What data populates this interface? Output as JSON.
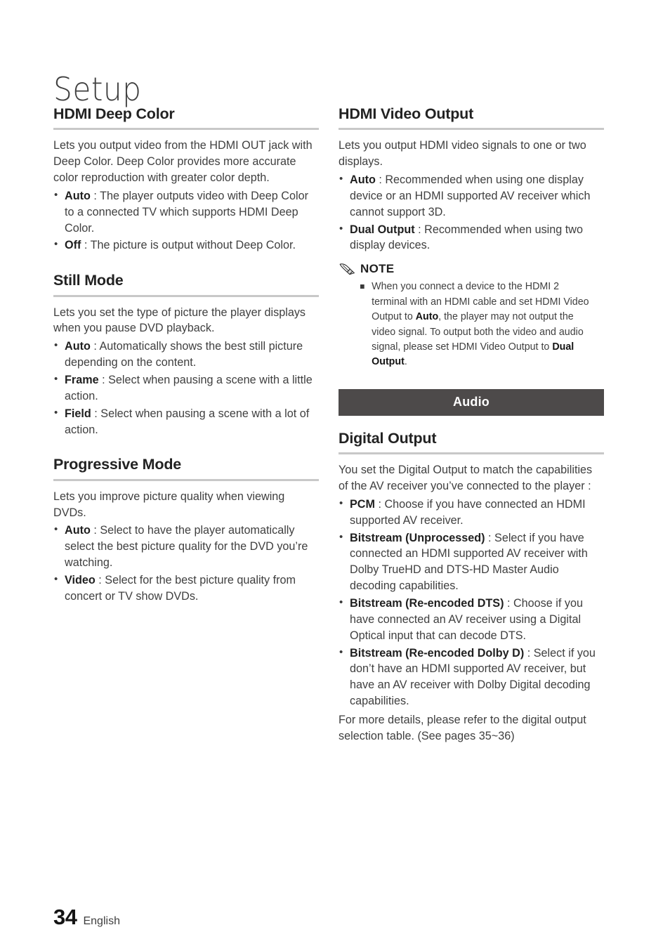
{
  "page": {
    "title": "Setup",
    "folio_number": "34",
    "folio_language": "English"
  },
  "colors": {
    "band_background": "#4d4a4a",
    "band_text": "#ffffff",
    "rule": "#c8c8c8",
    "body_text": "#3f3f3f",
    "heading_text": "#222222"
  },
  "left_column": {
    "sections": [
      {
        "heading": "HDMI Deep Color",
        "intro": "Lets you output video from the HDMI OUT jack with Deep Color. Deep Color provides more accurate color reproduction with greater color depth.",
        "bullets": [
          {
            "term": "Auto",
            "sep": " : ",
            "text": "The player outputs video with Deep Color to a connected TV which supports HDMI Deep Color."
          },
          {
            "term": "Off",
            "sep": " : ",
            "text": "The picture is output without Deep Color."
          }
        ]
      },
      {
        "heading": "Still Mode",
        "intro": "Lets you set the type of picture the player displays when you pause DVD playback.",
        "bullets": [
          {
            "term": "Auto",
            "sep": " : ",
            "text": "Automatically shows the best still picture depending on the content."
          },
          {
            "term": "Frame",
            "sep": " : ",
            "text": "Select when pausing a scene with a little action."
          },
          {
            "term": "Field",
            "sep": " : ",
            "text": "Select when pausing a scene with a lot of action."
          }
        ]
      },
      {
        "heading": "Progressive Mode",
        "intro": "Lets you improve picture quality when viewing DVDs.",
        "bullets": [
          {
            "term": "Auto",
            "sep": " : ",
            "text": "Select to have the player automatically select the best picture quality for the DVD you’re watching."
          },
          {
            "term": "Video",
            "sep": " : ",
            "text": "Select for the best picture quality from concert or TV show DVDs."
          }
        ]
      }
    ]
  },
  "right_column": {
    "hdmi_video_output": {
      "heading": "HDMI Video Output",
      "intro": "Lets you output HDMI video signals to one or two displays.",
      "bullets": [
        {
          "term": "Auto",
          "sep": " : ",
          "text": "Recommended when using one display device or an HDMI supported AV receiver which cannot support 3D."
        },
        {
          "term": "Dual Output",
          "sep": " : ",
          "text": "Recommended when using two display devices."
        }
      ]
    },
    "note": {
      "icon": "pencil-icon",
      "title": "NOTE",
      "items": [
        {
          "part1": "When you connect a device to the HDMI 2 terminal with an HDMI cable and set HDMI Video Output to ",
          "bold1": "Auto",
          "part2": ", the player may not output the video signal. To output both the video and audio signal, please set HDMI Video Output to ",
          "bold2": "Dual Output",
          "part3": "."
        }
      ]
    },
    "band": {
      "label": "Audio"
    },
    "digital_output": {
      "heading": "Digital Output",
      "intro": "You set the Digital Output to match the capabilities of the AV receiver you’ve connected to the player :",
      "bullets": [
        {
          "term": "PCM",
          "sep": " : ",
          "text": "Choose if you have connected an HDMI supported AV receiver."
        },
        {
          "term": "Bitstream (Unprocessed)",
          "sep": " : ",
          "text": "Select if you have connected an HDMI supported AV receiver with Dolby TrueHD and DTS-HD Master Audio decoding capabilities."
        },
        {
          "term": "Bitstream (Re-encoded DTS)",
          "sep": " : ",
          "text": "Choose if you have connected an AV receiver using a Digital Optical input that can decode DTS."
        },
        {
          "term": "Bitstream (Re-encoded Dolby D)",
          "sep": " : ",
          "text": "Select if you don’t have an HDMI supported AV receiver, but have an AV receiver with Dolby Digital decoding capabilities."
        }
      ],
      "outro": "For more details, please refer to the digital output selection table. (See pages 35~36)"
    }
  }
}
